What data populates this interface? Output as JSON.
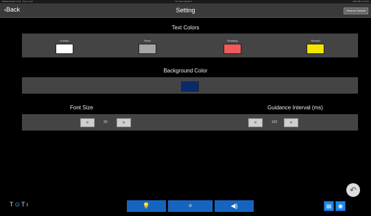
{
  "status_bar": {
    "left": "Waiwai project in Fiji · Tap to sync",
    "center": "You have signed in",
    "right": "2023-08-14 10:32"
  },
  "header": {
    "back_label": "Back",
    "title": "Setting",
    "restore_label": "Restore Default"
  },
  "text_colors": {
    "title": "Text Colors",
    "items": [
      {
        "label": "Unread",
        "color": "#ffffff"
      },
      {
        "label": "Read",
        "color": "#a6a6a6"
      },
      {
        "label": "Reading",
        "color": "#f05a5a"
      },
      {
        "label": "Reread",
        "color": "#f5e600"
      }
    ]
  },
  "background_color": {
    "title": "Background Color",
    "color": "#0b2a6e"
  },
  "font_size": {
    "title": "Font Size",
    "value": "80",
    "decrease_label": "«",
    "increase_label": "»"
  },
  "guidance_interval": {
    "title": "Guidance Interval (ms)",
    "value": "100",
    "decrease_label": "«",
    "increase_label": "»"
  },
  "footer": {
    "logo_left": "T",
    "logo_mid": "⊙",
    "logo_right": "Tı",
    "nav": [
      {
        "icon": "lightbulb-icon",
        "glyph": "💡"
      },
      {
        "icon": "pointer-icon",
        "glyph": "✧"
      },
      {
        "icon": "speaker-icon",
        "glyph": "◀)"
      }
    ],
    "right_icons": [
      {
        "icon": "slideshow-icon",
        "glyph": "▤"
      },
      {
        "icon": "camera-icon",
        "glyph": "◉"
      }
    ],
    "fab_glyph": "↶"
  },
  "colors": {
    "accent": "#1565c0",
    "panel": "#444444"
  }
}
